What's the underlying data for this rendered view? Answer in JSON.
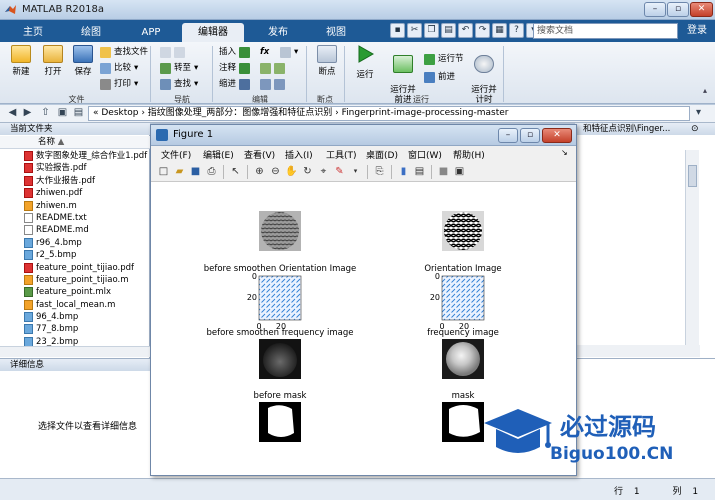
{
  "window": {
    "title": "MATLAB R2018a"
  },
  "tabs": [
    {
      "label": "主页"
    },
    {
      "label": "绘图"
    },
    {
      "label": "APP"
    },
    {
      "label": "编辑器"
    },
    {
      "label": "发布"
    },
    {
      "label": "视图"
    }
  ],
  "toolstrip": {
    "search_placeholder": "搜索文档",
    "login": "登录"
  },
  "ribbon": {
    "file": {
      "new": "新建",
      "open": "打开",
      "save": "保存",
      "find_files": "查找文件",
      "compare": "比较",
      "print": "打印",
      "group": "文件"
    },
    "navigate": {
      "goto": "转至",
      "find": "查找",
      "group": "导航"
    },
    "edit": {
      "insert": "插入",
      "comment": "注释",
      "indent": "缩进",
      "fx": "fx",
      "group": "编辑"
    },
    "breakpoints": {
      "label": "断点",
      "group": "断点"
    },
    "run": {
      "run": "运行",
      "run_advance": "运行并\n前进",
      "run_section": "运行节",
      "advance": "前进",
      "run_time": "运行并\n计时",
      "group": "运行"
    }
  },
  "address": {
    "path": "« Desktop › 指纹图像处理_两部分：图像增强和特征点识别 › Fingerprint-image-processing-master"
  },
  "folder_panel": {
    "title": "当前文件夹",
    "column": "名称",
    "files": [
      {
        "name": "数字图象处理_综合作业1.pdf",
        "type": "pdf"
      },
      {
        "name": "实验报告.pdf",
        "type": "pdf"
      },
      {
        "name": "大作业报告.pdf",
        "type": "pdf"
      },
      {
        "name": "zhiwen.pdf",
        "type": "pdf"
      },
      {
        "name": "zhiwen.m",
        "type": "m"
      },
      {
        "name": "README.txt",
        "type": "txt"
      },
      {
        "name": "README.md",
        "type": "txt"
      },
      {
        "name": "r96_4.bmp",
        "type": "bmp"
      },
      {
        "name": "r2_5.bmp",
        "type": "bmp"
      },
      {
        "name": "feature_point_tijiao.pdf",
        "type": "pdf"
      },
      {
        "name": "feature_point_tijiao.m",
        "type": "m"
      },
      {
        "name": "feature_point.mlx",
        "type": "mlx"
      },
      {
        "name": "fast_local_mean.m",
        "type": "m"
      },
      {
        "name": "96_4.bmp",
        "type": "bmp"
      },
      {
        "name": "77_8.bmp",
        "type": "bmp"
      },
      {
        "name": "23_2.bmp",
        "type": "bmp"
      }
    ]
  },
  "right_panel": {
    "header": "和特征点识别\\Finger..."
  },
  "details": {
    "title": "详细信息",
    "message": "选择文件以查看详细信息"
  },
  "status": {
    "row_label": "行",
    "row": "1",
    "col_label": "列",
    "col": "1"
  },
  "figure": {
    "title": "Figure 1",
    "menus": [
      "文件(F)",
      "编辑(E)",
      "查看(V)",
      "插入(I)",
      "工具(T)",
      "桌面(D)",
      "窗口(W)",
      "帮助(H)"
    ],
    "subplots": {
      "orient_before_title": "before smoothen Orientation Image",
      "orient_title": "Orientation Image",
      "freq_before_title": "before smoothen frequency image",
      "freq_title": "frequency image",
      "mask_before_title": "before mask",
      "mask_title": "mask",
      "y_ticks": [
        "0",
        "20"
      ],
      "x_ticks": [
        "0",
        "20"
      ]
    }
  },
  "watermark": {
    "line1": "必过源码",
    "line2": "Biguo100.CN"
  }
}
